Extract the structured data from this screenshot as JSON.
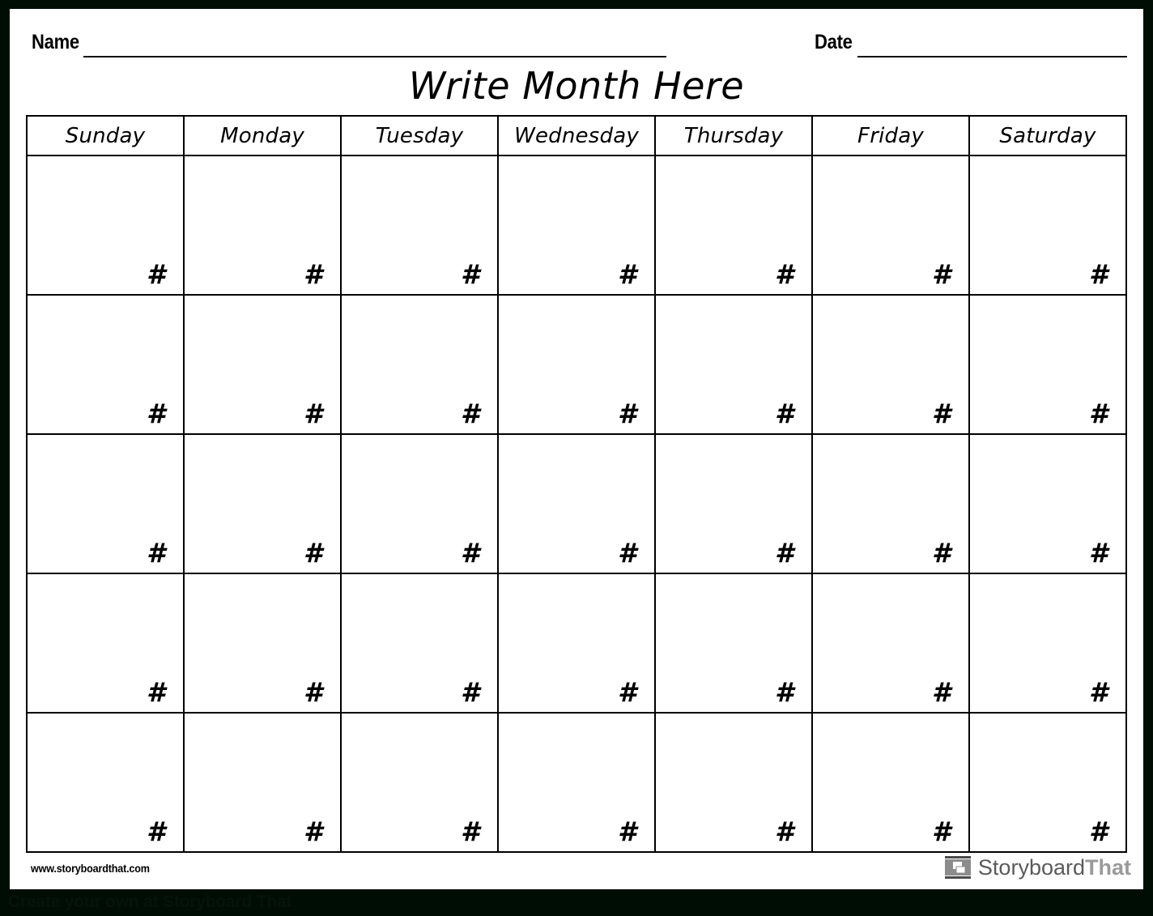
{
  "header": {
    "name_label": "Name",
    "date_label": "Date"
  },
  "title": "Write Month Here",
  "calendar": {
    "day_headers": [
      "Sunday",
      "Monday",
      "Tuesday",
      "Wednesday",
      "Thursday",
      "Friday",
      "Saturday"
    ],
    "rows": [
      [
        "#",
        "#",
        "#",
        "#",
        "#",
        "#",
        "#"
      ],
      [
        "#",
        "#",
        "#",
        "#",
        "#",
        "#",
        "#"
      ],
      [
        "#",
        "#",
        "#",
        "#",
        "#",
        "#",
        "#"
      ],
      [
        "#",
        "#",
        "#",
        "#",
        "#",
        "#",
        "#"
      ],
      [
        "#",
        "#",
        "#",
        "#",
        "#",
        "#",
        "#"
      ]
    ]
  },
  "footer": {
    "site_url": "www.storyboardthat.com",
    "logo": {
      "icon": "storyboard-panels-icon",
      "word_primary": "Storyboard",
      "word_secondary": "That"
    }
  },
  "promo": {
    "text": "Create your own at Storyboard That"
  },
  "colors": {
    "page_border": "#000d04",
    "page_background": "#ffffff",
    "ink": "#000000",
    "logo_primary": "#5a5a5a",
    "logo_secondary": "#9a9a9a",
    "promo_text": "#05140a"
  }
}
